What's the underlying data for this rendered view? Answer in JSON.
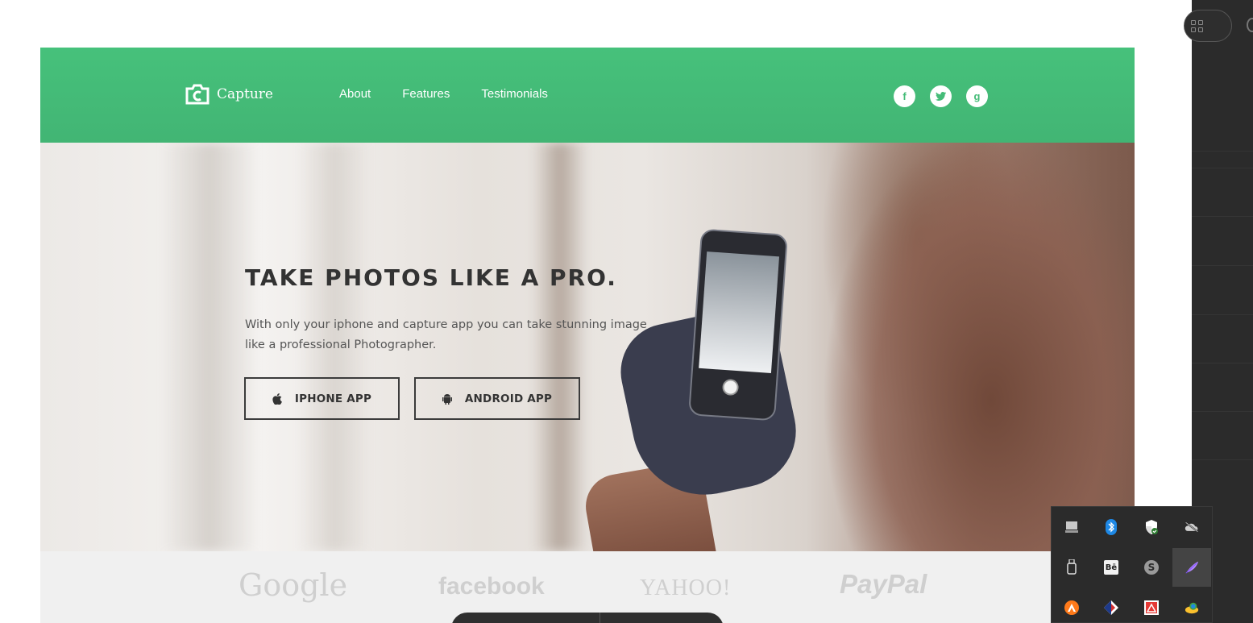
{
  "site": {
    "brand": "Capture",
    "nav": [
      "About",
      "Features",
      "Testimonials"
    ],
    "social": [
      {
        "name": "facebook",
        "glyph": "f"
      },
      {
        "name": "twitter",
        "glyph": "t"
      },
      {
        "name": "google-plus",
        "glyph": "g"
      }
    ],
    "accent_color": "#45bc78"
  },
  "hero": {
    "title": "TAKE PHOTOS LIKE A PRO.",
    "subtitle": "With only your iphone and capture app you can take stunning image like a professional Photographer.",
    "buttons": {
      "iphone": "IPHONE APP",
      "android": "ANDROID APP"
    }
  },
  "brands": [
    "Google",
    "facebook",
    "YAHOO!",
    "PayPal"
  ],
  "tray": {
    "icons": [
      "monitor-icon",
      "bluetooth-icon",
      "security-shield-icon",
      "cloud-offline-icon",
      "usb-drive-icon",
      "be-app-icon",
      "skype-icon",
      "feather-pen-icon",
      "avast-icon",
      "tricolor-app-icon",
      "acrobat-icon",
      "network-globe-icon"
    ]
  }
}
